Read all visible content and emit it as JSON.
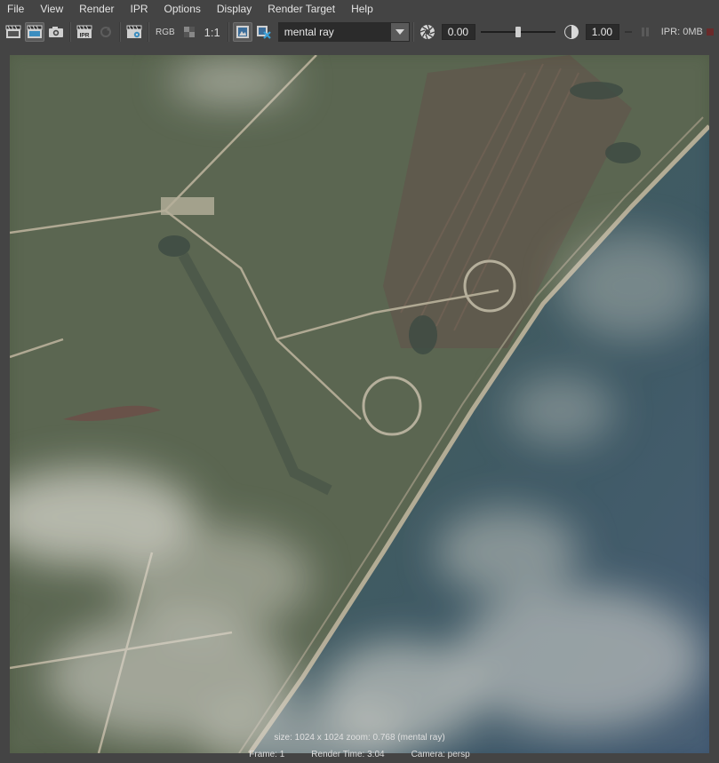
{
  "menu": [
    "File",
    "View",
    "Render",
    "IPR",
    "Options",
    "Display",
    "Render Target",
    "Help"
  ],
  "toolbar": {
    "rgb_label": "RGB",
    "one_to_one_label": "1:1",
    "renderer": "mental ray",
    "exposure_value": "0.00",
    "exposure_fraction": 0.5,
    "gamma_value": "1.00",
    "ipr_memory": "IPR: 0MB"
  },
  "render_info": {
    "size_line": "size: 1024 x 1024 zoom: 0.768 (mental ray)",
    "frame": "Frame: 1",
    "render_time": "Render Time: 3:04",
    "camera": "Camera: persp"
  },
  "icons": [
    "render-frame-icon",
    "redo-render-icon",
    "snapshot-icon",
    "ipr-render-icon",
    "refresh-ipr-icon",
    "render-settings-icon",
    "rgb-channel-icon",
    "alpha-channel-icon",
    "real-size-icon",
    "keep-image-icon",
    "remove-image-icon",
    "exposure-icon",
    "gamma-icon",
    "pause-icon",
    "stop-icon"
  ]
}
